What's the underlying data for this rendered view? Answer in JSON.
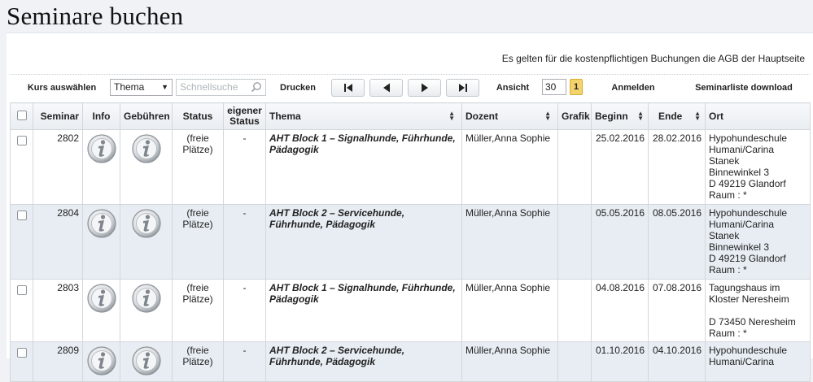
{
  "page": {
    "title": "Seminare buchen"
  },
  "notice": "Es gelten für die kostenpflichtigen Buchungen die AGB der Hauptseite",
  "toolbar": {
    "select_course": "Kurs auswählen",
    "filter_select": "Thema",
    "search_placeholder": "Schnellsuche",
    "print": "Drucken",
    "view_label": "Ansicht",
    "view_count": "30",
    "page": "1",
    "register": "Anmelden",
    "download": "Seminarliste download"
  },
  "table": {
    "headers": {
      "seminar": "Seminar",
      "info": "Info",
      "fees": "Gebühren",
      "status": "Status",
      "own_status": "eigener Status",
      "theme": "Thema",
      "lecturer": "Dozent",
      "graphic": "Grafik",
      "start": "Beginn",
      "end": "Ende",
      "location": "Ort"
    },
    "rows": [
      {
        "id": "2802",
        "status": "(freie Plätze)",
        "own_status": "-",
        "theme": "AHT Block 1 – Signalhunde, Führhunde, Pädagogik",
        "lecturer": "Müller,Anna Sophie",
        "start": "25.02.2016",
        "end": "28.02.2016",
        "location": [
          "Hypohundeschule",
          "Humani/Carina",
          "Stanek",
          "Binnewinkel 3",
          "D 49219 Glandorf",
          "Raum : *"
        ]
      },
      {
        "id": "2804",
        "status": "(freie Plätze)",
        "own_status": "-",
        "theme": "AHT Block 2 – Servicehunde, Führhunde, Pädagogik",
        "lecturer": "Müller,Anna Sophie",
        "start": "05.05.2016",
        "end": "08.05.2016",
        "location": [
          "Hypohundeschule",
          "Humani/Carina",
          "Stanek",
          "Binnewinkel 3",
          "D 49219 Glandorf",
          "Raum : *"
        ]
      },
      {
        "id": "2803",
        "status": "(freie Plätze)",
        "own_status": "-",
        "theme": "AHT Block 1 – Signalhunde, Führhunde, Pädagogik",
        "lecturer": "Müller,Anna Sophie",
        "start": "04.08.2016",
        "end": "07.08.2016",
        "location": [
          "Tagungshaus im",
          "Kloster Neresheim",
          "",
          "D 73450 Neresheim",
          "Raum : *"
        ]
      },
      {
        "id": "2809",
        "status": "(freie Plätze)",
        "own_status": "-",
        "theme": "AHT Block 2 – Servicehunde, Führhunde, Pädagogik",
        "lecturer": "Müller,Anna Sophie",
        "start": "01.10.2016",
        "end": "04.10.2016",
        "location": [
          "Hypohundeschule",
          "Humani/Carina"
        ]
      }
    ]
  }
}
